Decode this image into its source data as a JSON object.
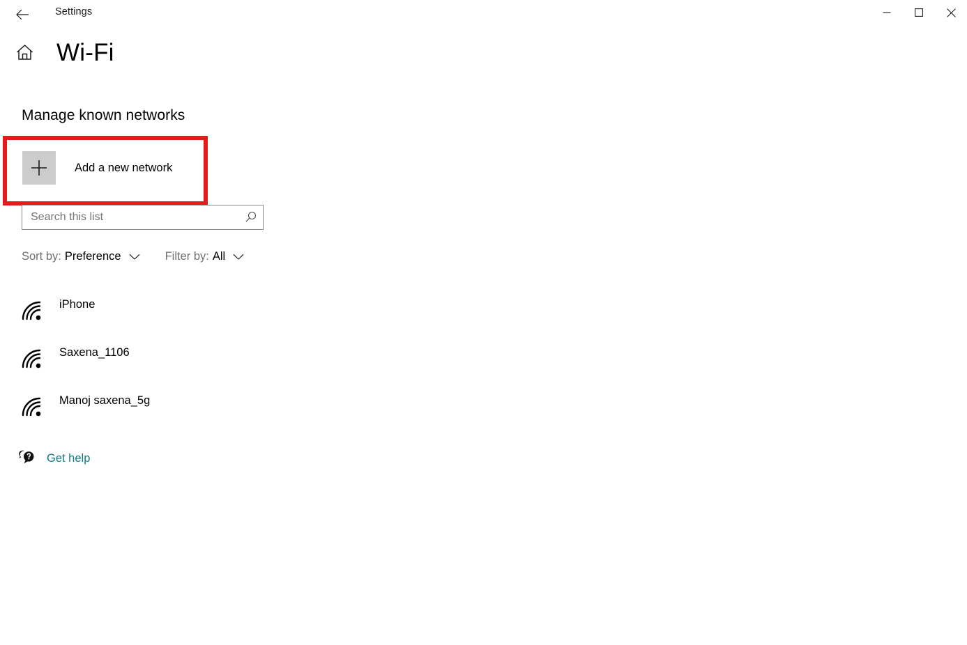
{
  "window": {
    "app_title": "Settings",
    "back_icon": "back-arrow-icon",
    "controls": {
      "minimize": "minimize-icon",
      "maximize": "maximize-icon",
      "close": "close-icon"
    }
  },
  "page": {
    "home_icon": "home-icon",
    "title": "Wi-Fi",
    "section_heading": "Manage known networks"
  },
  "add_network": {
    "icon": "plus-icon",
    "label": "Add a new network",
    "highlighted": true,
    "highlight_color": "#e81919"
  },
  "search": {
    "value": "",
    "placeholder": "Search this list",
    "icon": "search-icon"
  },
  "filters": [
    {
      "prefix": "Sort by:",
      "value": "Preference",
      "icon": "chevron-down-icon"
    },
    {
      "prefix": "Filter by:",
      "value": "All",
      "icon": "chevron-down-icon"
    }
  ],
  "networks": [
    {
      "name": "iPhone",
      "icon": "wifi-icon"
    },
    {
      "name": "Saxena_1106",
      "icon": "wifi-icon"
    },
    {
      "name": "Manoj saxena_5g",
      "icon": "wifi-icon"
    }
  ],
  "help": {
    "label": "Get help",
    "icon": "help-chat-icon",
    "color": "#0f7b86"
  }
}
